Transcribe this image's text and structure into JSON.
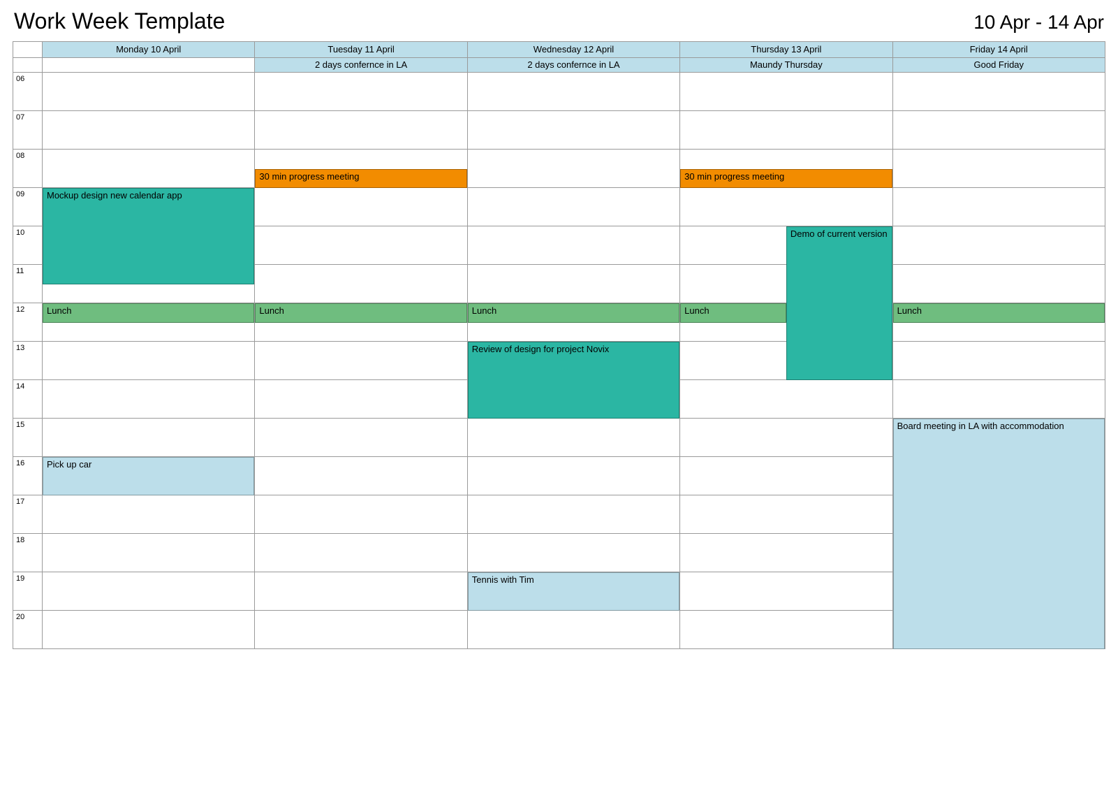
{
  "header": {
    "title": "Work Week Template",
    "range": "10 Apr - 14 Apr"
  },
  "days": [
    {
      "label": "Monday 10 April",
      "allday": ""
    },
    {
      "label": "Tuesday 11 April",
      "allday": "2 days confernce in LA"
    },
    {
      "label": "Wednesday 12 April",
      "allday": "2 days confernce in LA"
    },
    {
      "label": "Thursday 13 April",
      "allday": "Maundy Thursday"
    },
    {
      "label": "Friday 14 April",
      "allday": "Good Friday"
    }
  ],
  "hours": [
    "06",
    "07",
    "08",
    "09",
    "10",
    "11",
    "12",
    "13",
    "14",
    "15",
    "16",
    "17",
    "18",
    "19",
    "20"
  ],
  "events": [
    {
      "day": 0,
      "startHour": 9,
      "endHour": 11.5,
      "label": "Mockup design new calendar app",
      "color": "teal"
    },
    {
      "day": 0,
      "startHour": 12,
      "endHour": 12.5,
      "label": "Lunch",
      "color": "green"
    },
    {
      "day": 0,
      "startHour": 16,
      "endHour": 17,
      "label": "Pick up car",
      "color": "blue"
    },
    {
      "day": 1,
      "startHour": 8.5,
      "endHour": 9,
      "label": "30 min progress meeting",
      "color": "orange"
    },
    {
      "day": 1,
      "startHour": 12,
      "endHour": 12.5,
      "label": "Lunch",
      "color": "green"
    },
    {
      "day": 2,
      "startHour": 12,
      "endHour": 12.5,
      "label": "Lunch",
      "color": "green"
    },
    {
      "day": 2,
      "startHour": 13,
      "endHour": 15,
      "label": "Review of design for project Novix",
      "color": "teal"
    },
    {
      "day": 2,
      "startHour": 19,
      "endHour": 20,
      "label": "Tennis with Tim",
      "color": "blue"
    },
    {
      "day": 3,
      "startHour": 8.5,
      "endHour": 9,
      "label": "30 min progress meeting",
      "color": "orange"
    },
    {
      "day": 3,
      "startHour": 10,
      "endHour": 14,
      "label": "Demo of current version",
      "color": "teal",
      "rightHalf": true
    },
    {
      "day": 3,
      "startHour": 12,
      "endHour": 12.5,
      "label": "Lunch",
      "color": "green",
      "leftHalf": true
    },
    {
      "day": 4,
      "startHour": 12,
      "endHour": 12.5,
      "label": "Lunch",
      "color": "green"
    },
    {
      "day": 4,
      "startHour": 15,
      "endHour": 21,
      "label": "Board meeting in LA with accommodation",
      "color": "blue"
    }
  ],
  "layout": {
    "startHour": 6,
    "hourHeight": 55
  }
}
